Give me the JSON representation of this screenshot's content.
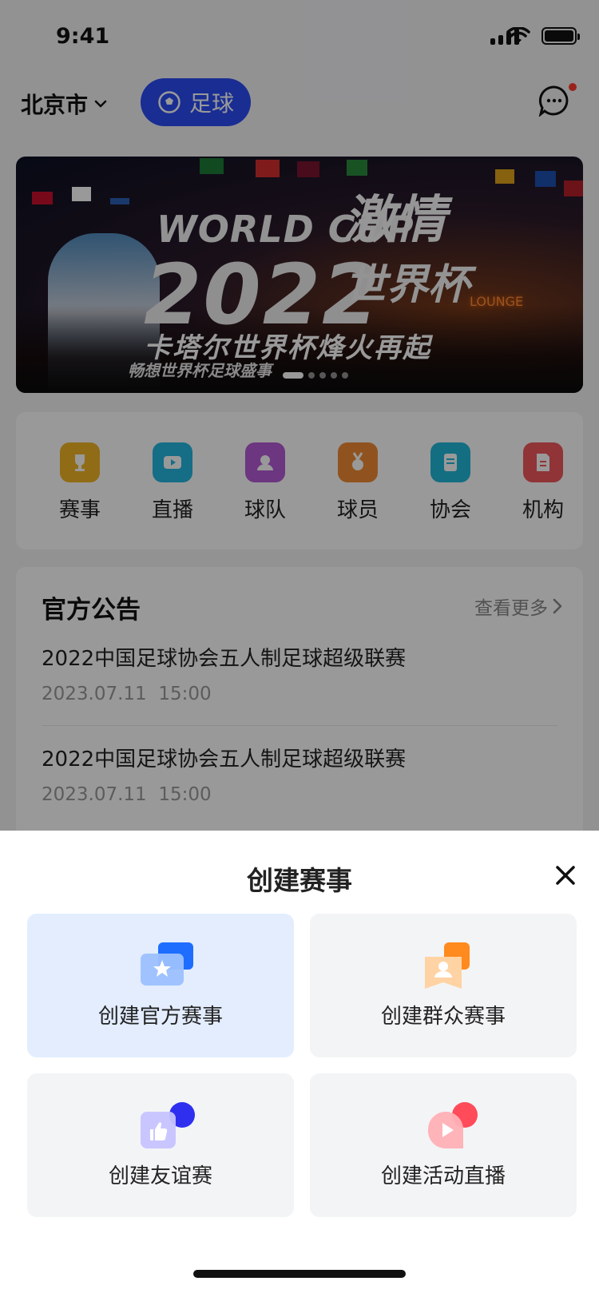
{
  "status_bar": {
    "time": "9:41"
  },
  "header": {
    "city": "北京市",
    "sport": "足球"
  },
  "banner": {
    "headline_en": "WORLD CUP",
    "headline_cn": "激情",
    "year": "2022",
    "cup": "世界杯",
    "subtitle": "卡塔尔世界杯烽火再起",
    "tagline": "畅想世界杯足球盛事",
    "neon_sign": "LOUNGE",
    "slides_total": 5,
    "slide_active": 1
  },
  "features": [
    {
      "label": "赛事",
      "icon": "trophy-icon",
      "color": "#f0b526"
    },
    {
      "label": "直播",
      "icon": "live-icon",
      "color": "#23b6e0"
    },
    {
      "label": "球队",
      "icon": "team-icon",
      "color": "#b45bd6"
    },
    {
      "label": "球员",
      "icon": "player-medal-icon",
      "color": "#f08a35"
    },
    {
      "label": "协会",
      "icon": "association-icon",
      "color": "#22b7d9"
    },
    {
      "label": "机构",
      "icon": "organization-icon",
      "color": "#f0575c"
    }
  ],
  "announcements": {
    "title": "官方公告",
    "more": "查看更多",
    "items": [
      {
        "title": "2022中国足球协会五人制足球超级联赛",
        "date": "2023.07.11",
        "time": "15:00"
      },
      {
        "title": "2022中国足球协会五人制足球超级联赛",
        "date": "2023.07.11",
        "time": "15:00"
      }
    ]
  },
  "sheet": {
    "title": "创建赛事",
    "options": [
      {
        "label": "创建官方赛事",
        "icon": "official-event-icon",
        "accent": "#1e6dff",
        "selected": true
      },
      {
        "label": "创建群众赛事",
        "icon": "public-event-icon",
        "accent": "#ff8a1e",
        "selected": false
      },
      {
        "label": "创建友谊赛",
        "icon": "friendly-match-icon",
        "accent": "#2f2ff0",
        "selected": false
      },
      {
        "label": "创建活动直播",
        "icon": "live-stream-icon",
        "accent": "#ff4b5a",
        "selected": false
      }
    ]
  }
}
